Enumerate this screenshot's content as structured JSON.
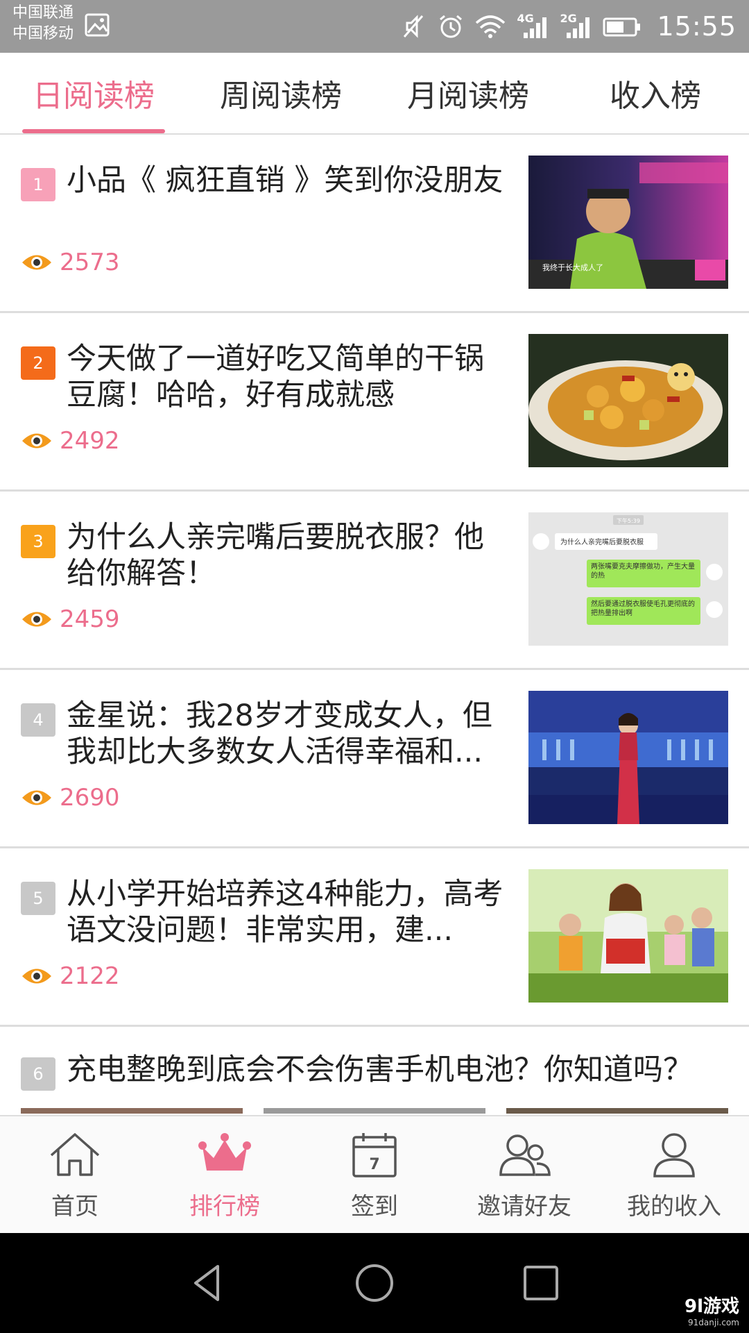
{
  "status": {
    "carrier1": "中国联通",
    "carrier2": "中国移动",
    "net1": "4G",
    "net2": "2G",
    "time": "15:55"
  },
  "tabs": [
    {
      "label": "日阅读榜",
      "active": true
    },
    {
      "label": "周阅读榜",
      "active": false
    },
    {
      "label": "月阅读榜",
      "active": false
    },
    {
      "label": "收入榜",
      "active": false
    }
  ],
  "items": [
    {
      "rank": "1",
      "rank_color": "#f7a1b8",
      "title": "小品《 疯狂直销 》笑到你没朋友",
      "views": "2573"
    },
    {
      "rank": "2",
      "rank_color": "#f46b1a",
      "title": "今天做了一道好吃又简单的干锅豆腐！哈哈，好有成就感",
      "views": "2492"
    },
    {
      "rank": "3",
      "rank_color": "#f9a21b",
      "title": "为什么人亲完嘴后要脱衣服？他给你解答！",
      "views": "2459",
      "chat": {
        "time": "下午5:39",
        "q": "为什么人亲完嘴后要脱衣服",
        "a1": "两张嘴要克夫摩擦做功，产生大量的热",
        "a2": "然后要通过脱衣服使毛孔更彻底的把热量排出啊"
      }
    },
    {
      "rank": "4",
      "rank_color": "#c8c8c8",
      "title": "金星说：我28岁才变成女人，但我却比大多数女人活得幸福和...",
      "views": "2690"
    },
    {
      "rank": "5",
      "rank_color": "#c8c8c8",
      "title": "从小学开始培养这4种能力，高考语文没问题！非常实用，建...",
      "views": "2122"
    },
    {
      "rank": "6",
      "rank_color": "#c8c8c8",
      "title": "充电整晚到底会不会伤害手机电池？你知道吗？"
    }
  ],
  "thumb1_caption": "我终于长大成人了",
  "nav": [
    {
      "label": "首页",
      "icon": "home-icon",
      "active": false
    },
    {
      "label": "排行榜",
      "icon": "crown-icon",
      "active": true
    },
    {
      "label": "签到",
      "icon": "calendar-icon",
      "active": false,
      "calendar_day": "7"
    },
    {
      "label": "邀请好友",
      "icon": "friends-icon",
      "active": false
    },
    {
      "label": "我的收入",
      "icon": "user-icon",
      "active": false
    }
  ],
  "watermark": {
    "main": "9l游戏",
    "sub": "91danji.com"
  },
  "colors": {
    "accent": "#ec6d8c",
    "views": "#ec6d8c",
    "eye": "#f39a1c"
  }
}
